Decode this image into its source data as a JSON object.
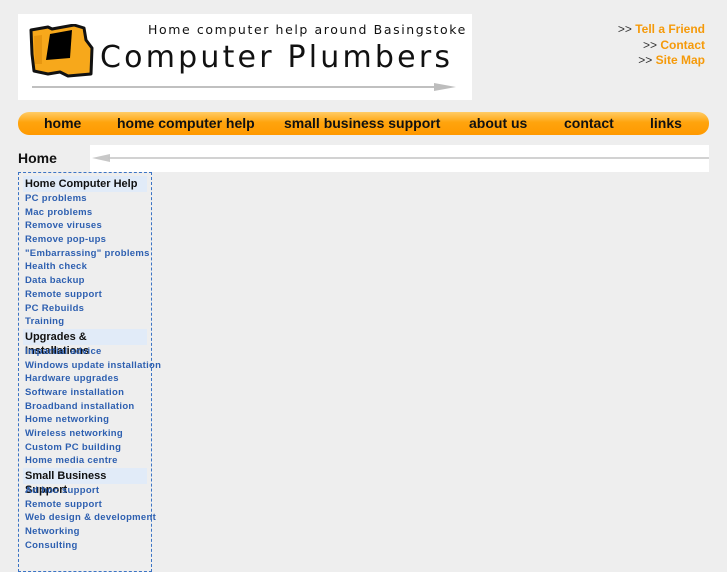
{
  "header": {
    "tagline": "Home computer help around Basingstoke",
    "brand": "Computer Plumbers",
    "brand_color": "#f5a623"
  },
  "toplinks": [
    {
      "prefix": ">>",
      "label": "Tell a Friend"
    },
    {
      "prefix": ">>",
      "label": "Contact"
    },
    {
      "prefix": ">>",
      "label": "Site Map"
    }
  ],
  "nav": {
    "accent": "#ff9900",
    "items": [
      {
        "label": "home"
      },
      {
        "label": "home computer help"
      },
      {
        "label": "small business support"
      },
      {
        "label": "about us"
      },
      {
        "label": "contact"
      },
      {
        "label": "links"
      }
    ]
  },
  "breadcrumb": {
    "title": "Home"
  },
  "sidebar": {
    "sections": [
      {
        "heading": "Home Computer Help",
        "items": [
          "PC problems",
          "Mac problems",
          "Remove viruses",
          "Remove pop-ups",
          "\"Embarrassing\" problems",
          "Health check",
          "Data backup",
          "Remote support",
          "PC Rebuilds",
          "Training"
        ]
      },
      {
        "heading": "Upgrades & Installations",
        "items": [
          "Impartial advice",
          "Windows update installation",
          "Hardware upgrades",
          "Software installation",
          "Broadband installation",
          "Home networking",
          "Wireless networking",
          "Custom PC building",
          "Home media centre"
        ]
      },
      {
        "heading": "Small Business Support",
        "items": [
          "Ad hoc support",
          "Remote support",
          "Web design & development",
          "Networking",
          "Consulting"
        ]
      }
    ]
  }
}
